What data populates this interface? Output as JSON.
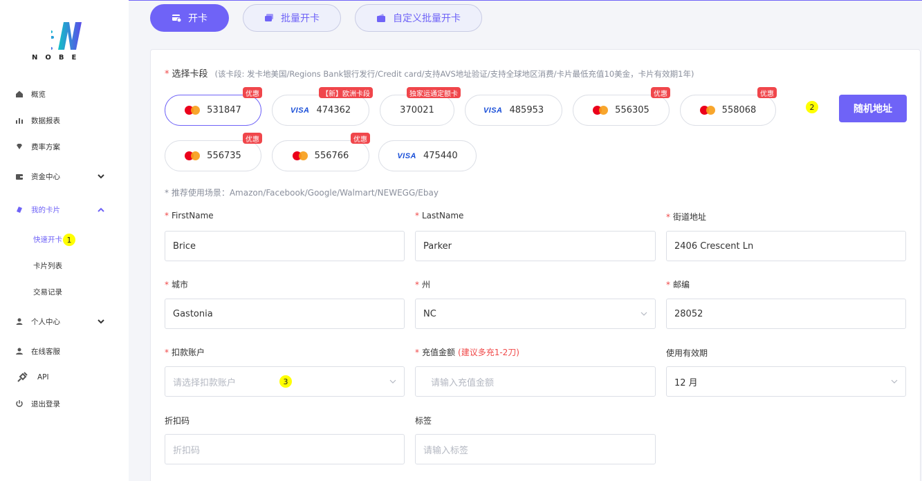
{
  "brand": {
    "logo_text": "NOBE",
    "accent": "#6f63f7"
  },
  "sidebar": {
    "items": [
      {
        "label": "概览",
        "icon": "home-icon"
      },
      {
        "label": "数据报表",
        "icon": "bar-chart-icon"
      },
      {
        "label": "费率方案",
        "icon": "diamond-icon"
      },
      {
        "label": "资金中心",
        "icon": "wallet-icon"
      },
      {
        "label": "我的卡片",
        "icon": "card-icon"
      },
      {
        "label": "个人中心",
        "icon": "user-icon"
      },
      {
        "label": "在线客服",
        "icon": "support-icon"
      },
      {
        "label": "API",
        "icon": "plug-icon"
      },
      {
        "label": "退出登录",
        "icon": "power-icon"
      }
    ],
    "sub_items": [
      {
        "label": "快速开卡"
      },
      {
        "label": "卡片列表"
      },
      {
        "label": "交易记录"
      }
    ]
  },
  "markers": [
    "1",
    "2",
    "3"
  ],
  "tabs": [
    {
      "label": "开卡",
      "icon": "card-plus-icon"
    },
    {
      "label": "批量开卡",
      "icon": "cards-icon"
    },
    {
      "label": "自定义批量开卡",
      "icon": "wallet-card-icon"
    }
  ],
  "card_segment": {
    "label": "选择卡段",
    "hint": "(该卡段: 发卡地美国/Regions Bank银行发行/Credit card/支持AVS地址验证/支持全球地区消费/卡片最低充值10美金，卡片有效期1年)",
    "chips": [
      {
        "bin": "531847",
        "brand": "mastercard",
        "badge": "优惠"
      },
      {
        "bin": "474362",
        "brand": "visa",
        "brand_label": "VISA",
        "badge": "【新】欧洲卡段"
      },
      {
        "bin": "370021",
        "brand": "none",
        "badge": "独家运通定额卡"
      },
      {
        "bin": "485953",
        "brand": "visa",
        "brand_label": "VISA",
        "badge": ""
      },
      {
        "bin": "556305",
        "brand": "mastercard",
        "badge": "优惠"
      },
      {
        "bin": "558068",
        "brand": "mastercard",
        "badge": "优惠"
      },
      {
        "bin": "556735",
        "brand": "mastercard",
        "badge": "优惠"
      },
      {
        "bin": "556766",
        "brand": "mastercard",
        "badge": "优惠"
      },
      {
        "bin": "475440",
        "brand": "visa",
        "brand_label": "VISA",
        "badge": ""
      }
    ],
    "scenario_hint": "* 推荐使用场景：Amazon/Facebook/Google/Walmart/NEWEGG/Ebay",
    "random_button": "随机地址"
  },
  "form": {
    "first_name": {
      "label": "FirstName",
      "value": "Brice"
    },
    "last_name": {
      "label": "LastName",
      "value": "Parker"
    },
    "street": {
      "label": "街道地址",
      "value": "2406 Crescent Ln"
    },
    "city": {
      "label": "城市",
      "value": "Gastonia"
    },
    "state": {
      "label": "州",
      "value": "NC"
    },
    "zip": {
      "label": "邮编",
      "value": "28052"
    },
    "account": {
      "label": "扣款账户",
      "placeholder": "请选择扣款账户"
    },
    "amount": {
      "label": "充值金额",
      "hint": "(建议多充1-2刀)",
      "placeholder": "请输入充值金额"
    },
    "validity": {
      "label": "使用有效期",
      "value": "12 月"
    },
    "discount": {
      "label": "折扣码",
      "placeholder": "折扣码"
    },
    "tag": {
      "label": "标签",
      "placeholder": "请输入标签"
    }
  }
}
